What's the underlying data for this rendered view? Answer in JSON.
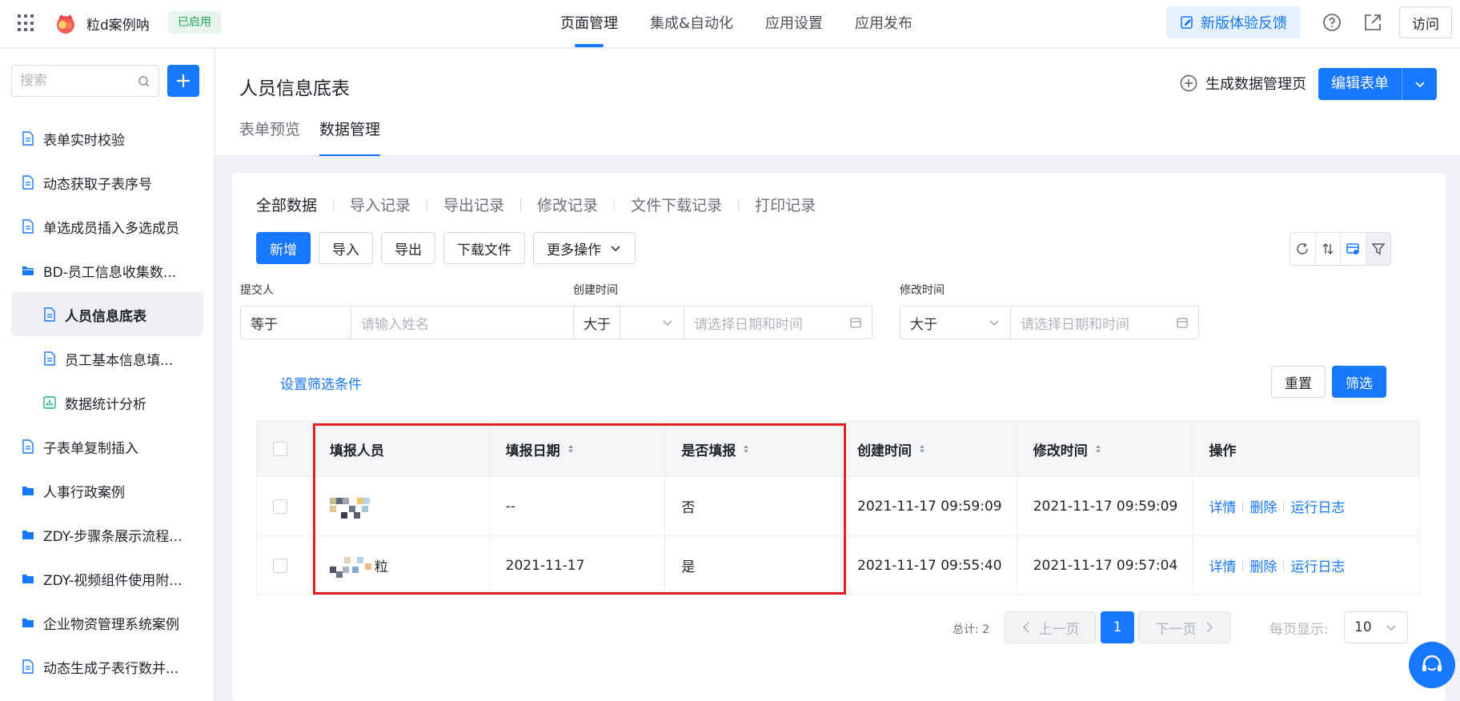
{
  "topbar": {
    "app_name": "粒d案例呐",
    "app_status": "已启用",
    "nav": [
      "页面管理",
      "集成&自动化",
      "应用设置",
      "应用发布"
    ],
    "feedback_label": "新版体验反馈",
    "visit_label": "访问",
    "accent_color": "#1677ff"
  },
  "sidebar": {
    "search_placeholder": "搜索",
    "items": [
      {
        "label": "表单实时校验",
        "icon": "form-icon"
      },
      {
        "label": "动态获取子表序号",
        "icon": "form-icon"
      },
      {
        "label": "单选成员插入多选成员",
        "icon": "form-icon"
      },
      {
        "label": "BD-员工信息收集数...",
        "icon": "folder-open-icon"
      },
      {
        "label": "人员信息底表",
        "icon": "form-icon"
      },
      {
        "label": "员工基本信息填...",
        "icon": "form-icon"
      },
      {
        "label": "数据统计分析",
        "icon": "chart-icon"
      },
      {
        "label": "子表单复制插入",
        "icon": "form-icon"
      },
      {
        "label": "人事行政案例",
        "icon": "folder-icon"
      },
      {
        "label": "ZDY-步骤条展示流程...",
        "icon": "folder-icon"
      },
      {
        "label": "ZDY-视频组件使用附...",
        "icon": "folder-icon"
      },
      {
        "label": "企业物资管理系统案例",
        "icon": "folder-icon"
      },
      {
        "label": "动态生成子表行数并...",
        "icon": "form-icon"
      }
    ]
  },
  "header": {
    "title": "人员信息底表",
    "tabs": [
      "表单预览",
      "数据管理"
    ],
    "generate_label": "生成数据管理页",
    "edit_label": "编辑表单"
  },
  "records": {
    "tabs": [
      "全部数据",
      "导入记录",
      "导出记录",
      "修改记录",
      "文件下载记录",
      "打印记录"
    ]
  },
  "actions": {
    "add": "新增",
    "import": "导入",
    "export": "导出",
    "download": "下载文件",
    "more": "更多操作"
  },
  "filters": {
    "submitter": {
      "label": "提交人",
      "op": "等于",
      "placeholder": "请输入姓名"
    },
    "created": {
      "label": "创建时间",
      "op": "大于",
      "placeholder": "请选择日期和时间"
    },
    "modified": {
      "label": "修改时间",
      "op": "大于",
      "placeholder": "请选择日期和时间"
    },
    "set_link": "设置筛选条件",
    "reset": "重置",
    "apply": "筛选"
  },
  "table": {
    "columns": [
      "填报人员",
      "填报日期",
      "是否填报",
      "创建时间",
      "修改时间",
      "操作"
    ],
    "rows": [
      {
        "reporter": "",
        "date": "--",
        "filled": "否",
        "created": "2021-11-17 09:59:09",
        "modified": "2021-11-17 09:59:09"
      },
      {
        "reporter": "粒",
        "date": "2021-11-17",
        "filled": "是",
        "created": "2021-11-17 09:55:40",
        "modified": "2021-11-17 09:57:04"
      }
    ],
    "ops": [
      "详情",
      "删除",
      "运行日志"
    ]
  },
  "pagination": {
    "total": "总计: 2",
    "prev": "上一页",
    "current": "1",
    "next": "下一页",
    "per_page_label": "每页显示:",
    "per_page": "10"
  }
}
